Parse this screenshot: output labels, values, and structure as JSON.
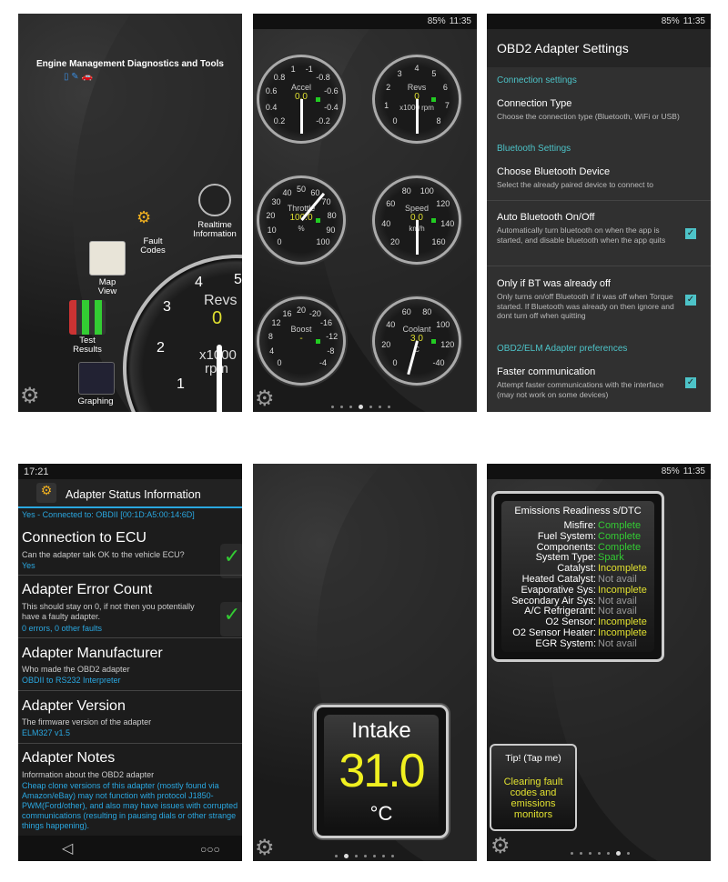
{
  "panel1": {
    "title": "Engine Management Diagnostics and Tools",
    "menu": [
      {
        "label": "Realtime\nInformation",
        "icon": "gauge-icon"
      },
      {
        "label": "Fault\nCodes",
        "icon": "engine-warning-icon"
      },
      {
        "label": "Map\nView",
        "icon": "map-icon"
      },
      {
        "label": "Test\nResults",
        "icon": "bar-chart-icon"
      },
      {
        "label": "Graphing",
        "icon": "graph-icon"
      }
    ],
    "gauge": {
      "name": "Revs",
      "value": "0",
      "unit1": "x1000",
      "unit2": "rpm",
      "ticks": [
        "1",
        "2",
        "3",
        "4",
        "5"
      ]
    }
  },
  "status_bar": {
    "time": "11:35",
    "battery": "85%"
  },
  "panel2": {
    "gauges": [
      {
        "name": "Accel",
        "value": "0.0",
        "unit": "",
        "ticks": [
          "0.2",
          "0.4",
          "0.6",
          "0.8",
          "1",
          "-1",
          "-0.8",
          "-0.6",
          "-0.4",
          "-0.2"
        ]
      },
      {
        "name": "Revs",
        "value": "0",
        "unit": "x1000 rpm",
        "ticks": [
          "0",
          "1",
          "2",
          "3",
          "4",
          "5",
          "6",
          "7",
          "8"
        ]
      },
      {
        "name": "Throttle",
        "value": "100.0",
        "unit": "%",
        "ticks": [
          "0",
          "10",
          "20",
          "30",
          "40",
          "50",
          "60",
          "70",
          "80",
          "90",
          "100"
        ]
      },
      {
        "name": "Speed",
        "value": "0.0",
        "unit": "km/h",
        "ticks": [
          "20",
          "40",
          "60",
          "80",
          "100",
          "120",
          "140",
          "160"
        ]
      },
      {
        "name": "Boost",
        "value": "-",
        "unit": "",
        "ticks": [
          "0",
          "4",
          "8",
          "12",
          "16",
          "20",
          "-20",
          "-16",
          "-12",
          "-8",
          "-4"
        ]
      },
      {
        "name": "Coolant",
        "value": "3.0",
        "unit": "C",
        "ticks": [
          "0",
          "20",
          "40",
          "60",
          "80",
          "100",
          "120",
          "-40"
        ]
      }
    ]
  },
  "panel3": {
    "title": "OBD2 Adapter Settings",
    "sections": {
      "connection": "Connection settings",
      "bluetooth": "Bluetooth Settings",
      "elm": "OBD2/ELM Adapter preferences"
    },
    "items": [
      {
        "title": "Connection Type",
        "desc": "Choose the connection type (Bluetooth, WiFi or USB)"
      },
      {
        "title": "Choose Bluetooth Device",
        "desc": "Select the already paired device to connect to"
      },
      {
        "title": "Auto Bluetooth On/Off",
        "desc": "Automatically turn bluetooth on when the app is started, and disable bluetooth when the app quits",
        "checked": true
      },
      {
        "title": "Only if BT was already off",
        "desc": "Only turns on/off Bluetooth if it was off when Torque started. If Bluetooth was already on then ignore and dont turn off when quitting",
        "checked": true
      },
      {
        "title": "Faster communication",
        "desc": "Attempt faster communications with the interface (may not work on some devices)",
        "checked": true
      }
    ]
  },
  "panel4": {
    "time": "17:21",
    "title": "Adapter Status Information",
    "top_value": "Yes - Connected to: OBDII [00:1D:A5:00:14:6D]",
    "ok": "OK",
    "items": [
      {
        "title": "Connection to ECU",
        "desc": "Can the adapter talk OK to the vehicle ECU?",
        "value": "Yes"
      },
      {
        "title": "Adapter Error Count",
        "desc": "This should stay on 0, if not then you potentially have a faulty adapter.",
        "value": "0 errors, 0 other faults"
      },
      {
        "title": "Adapter Manufacturer",
        "desc": "Who made the OBD2 adapter",
        "value": "OBDII to RS232 Interpreter"
      },
      {
        "title": "Adapter Version",
        "desc": "The firmware version of the adapter",
        "value": "ELM327 v1.5"
      },
      {
        "title": "Adapter Notes",
        "desc": "Information about the OBD2 adapter",
        "value": "Cheap clone versions of this adapter (mostly found via Amazon/eBay) may not function with protocol J1850-PWM(Ford/other), and also may have issues with corrupted communications (resulting in pausing dials or other strange things happening)."
      }
    ]
  },
  "panel5": {
    "label": "Intake",
    "value": "31.0",
    "unit": "°C"
  },
  "panel6": {
    "title": "Emissions Readiness s/DTC",
    "rows": [
      [
        "Misfire:",
        "Complete",
        "#33cc33"
      ],
      [
        "Fuel System:",
        "Complete",
        "#33cc33"
      ],
      [
        "Components:",
        "Complete",
        "#33cc33"
      ],
      [
        "System Type:",
        "Spark",
        "#33cc33"
      ],
      [
        "Catalyst:",
        "Incomplete",
        "#e0e030"
      ],
      [
        "Heated Catalyst:",
        "Not avail",
        "#999999"
      ],
      [
        "Evaporative Sys:",
        "Incomplete",
        "#e0e030"
      ],
      [
        "Secondary Air Sys:",
        "Not avail",
        "#999999"
      ],
      [
        "A/C Refrigerant:",
        "Not avail",
        "#999999"
      ],
      [
        "O2 Sensor:",
        "Incomplete",
        "#e0e030"
      ],
      [
        "O2 Sensor Heater:",
        "Incomplete",
        "#e0e030"
      ],
      [
        "EGR System:",
        "Not avail",
        "#999999"
      ]
    ],
    "tip_title": "Tip! (Tap me)",
    "tip_text": "Clearing fault codes and emissions monitors"
  },
  "colors": {
    "accent": "#4dc3c8",
    "value_yellow": "#e0e030",
    "ok_green": "#33cc33",
    "link_blue": "#2aa7e0"
  }
}
